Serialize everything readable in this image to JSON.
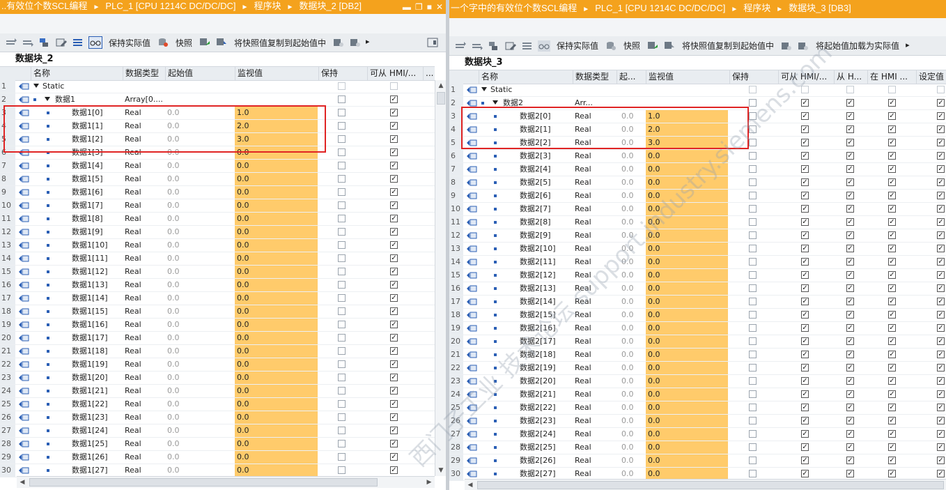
{
  "left": {
    "title": {
      "part1": "..有效位个数SCL编程",
      "part2": "PLC_1 [CPU 1214C DC/DC/DC]",
      "part3": "程序块",
      "part4": "数据块_2 [DB2]"
    },
    "toolbar": {
      "keep_actual": "保持实际值",
      "snapshot": "快照",
      "copy_snapshot": "将快照值复制到起始值中"
    },
    "block_name": "数据块_2",
    "columns": [
      "名称",
      "数据类型",
      "起始值",
      "监视值",
      "保持",
      "可从 HMI/...",
      "..."
    ],
    "static_label": "Static",
    "array_name": "数据1",
    "array_type": "Array[0....",
    "rows": [
      {
        "name": "数据1[0]",
        "type": "Real",
        "start": "0.0",
        "monitor": "1.0"
      },
      {
        "name": "数据1[1]",
        "type": "Real",
        "start": "0.0",
        "monitor": "2.0"
      },
      {
        "name": "数据1[2]",
        "type": "Real",
        "start": "0.0",
        "monitor": "3.0"
      },
      {
        "name": "数据1[3]",
        "type": "Real",
        "start": "0.0",
        "monitor": "0.0"
      },
      {
        "name": "数据1[4]",
        "type": "Real",
        "start": "0.0",
        "monitor": "0.0"
      },
      {
        "name": "数据1[5]",
        "type": "Real",
        "start": "0.0",
        "monitor": "0.0"
      },
      {
        "name": "数据1[6]",
        "type": "Real",
        "start": "0.0",
        "monitor": "0.0"
      },
      {
        "name": "数据1[7]",
        "type": "Real",
        "start": "0.0",
        "monitor": "0.0"
      },
      {
        "name": "数据1[8]",
        "type": "Real",
        "start": "0.0",
        "monitor": "0.0"
      },
      {
        "name": "数据1[9]",
        "type": "Real",
        "start": "0.0",
        "monitor": "0.0"
      },
      {
        "name": "数据1[10]",
        "type": "Real",
        "start": "0.0",
        "monitor": "0.0"
      },
      {
        "name": "数据1[11]",
        "type": "Real",
        "start": "0.0",
        "monitor": "0.0"
      },
      {
        "name": "数据1[12]",
        "type": "Real",
        "start": "0.0",
        "monitor": "0.0"
      },
      {
        "name": "数据1[13]",
        "type": "Real",
        "start": "0.0",
        "monitor": "0.0"
      },
      {
        "name": "数据1[14]",
        "type": "Real",
        "start": "0.0",
        "monitor": "0.0"
      },
      {
        "name": "数据1[15]",
        "type": "Real",
        "start": "0.0",
        "monitor": "0.0"
      },
      {
        "name": "数据1[16]",
        "type": "Real",
        "start": "0.0",
        "monitor": "0.0"
      },
      {
        "name": "数据1[17]",
        "type": "Real",
        "start": "0.0",
        "monitor": "0.0"
      },
      {
        "name": "数据1[18]",
        "type": "Real",
        "start": "0.0",
        "monitor": "0.0"
      },
      {
        "name": "数据1[19]",
        "type": "Real",
        "start": "0.0",
        "monitor": "0.0"
      },
      {
        "name": "数据1[20]",
        "type": "Real",
        "start": "0.0",
        "monitor": "0.0"
      },
      {
        "name": "数据1[21]",
        "type": "Real",
        "start": "0.0",
        "monitor": "0.0"
      },
      {
        "name": "数据1[22]",
        "type": "Real",
        "start": "0.0",
        "monitor": "0.0"
      },
      {
        "name": "数据1[23]",
        "type": "Real",
        "start": "0.0",
        "monitor": "0.0"
      },
      {
        "name": "数据1[24]",
        "type": "Real",
        "start": "0.0",
        "monitor": "0.0"
      },
      {
        "name": "数据1[25]",
        "type": "Real",
        "start": "0.0",
        "monitor": "0.0"
      },
      {
        "name": "数据1[26]",
        "type": "Real",
        "start": "0.0",
        "monitor": "0.0"
      },
      {
        "name": "数据1[27]",
        "type": "Real",
        "start": "0.0",
        "monitor": "0.0"
      }
    ]
  },
  "right": {
    "title": {
      "part1": "一个字中的有效位个数SCL编程",
      "part2": "PLC_1 [CPU 1214C DC/DC/DC]",
      "part3": "程序块",
      "part4": "数据块_3 [DB3]"
    },
    "toolbar": {
      "keep_actual": "保持实际值",
      "snapshot": "快照",
      "copy_snapshot": "将快照值复制到起始值中",
      "load_start": "将起始值加载为实际值"
    },
    "block_name": "数据块_3",
    "columns": [
      "名称",
      "数据类型",
      "起...",
      "监视值",
      "保持",
      "可从 HMI/...",
      "从 H...",
      "在 HMI ...",
      "设定值"
    ],
    "static_label": "Static",
    "array_name": "数据2",
    "array_type": "Arr...",
    "rows": [
      {
        "name": "数据2[0]",
        "type": "Real",
        "start": "0.0",
        "monitor": "1.0"
      },
      {
        "name": "数据2[1]",
        "type": "Real",
        "start": "0.0",
        "monitor": "2.0"
      },
      {
        "name": "数据2[2]",
        "type": "Real",
        "start": "0.0",
        "monitor": "3.0"
      },
      {
        "name": "数据2[3]",
        "type": "Real",
        "start": "0.0",
        "monitor": "0.0"
      },
      {
        "name": "数据2[4]",
        "type": "Real",
        "start": "0.0",
        "monitor": "0.0"
      },
      {
        "name": "数据2[5]",
        "type": "Real",
        "start": "0.0",
        "monitor": "0.0"
      },
      {
        "name": "数据2[6]",
        "type": "Real",
        "start": "0.0",
        "monitor": "0.0"
      },
      {
        "name": "数据2[7]",
        "type": "Real",
        "start": "0.0",
        "monitor": "0.0"
      },
      {
        "name": "数据2[8]",
        "type": "Real",
        "start": "0.0",
        "monitor": "0.0"
      },
      {
        "name": "数据2[9]",
        "type": "Real",
        "start": "0.0",
        "monitor": "0.0"
      },
      {
        "name": "数据2[10]",
        "type": "Real",
        "start": "0.0",
        "monitor": "0.0"
      },
      {
        "name": "数据2[11]",
        "type": "Real",
        "start": "0.0",
        "monitor": "0.0"
      },
      {
        "name": "数据2[12]",
        "type": "Real",
        "start": "0.0",
        "monitor": "0.0"
      },
      {
        "name": "数据2[13]",
        "type": "Real",
        "start": "0.0",
        "monitor": "0.0"
      },
      {
        "name": "数据2[14]",
        "type": "Real",
        "start": "0.0",
        "monitor": "0.0"
      },
      {
        "name": "数据2[15]",
        "type": "Real",
        "start": "0.0",
        "monitor": "0.0"
      },
      {
        "name": "数据2[16]",
        "type": "Real",
        "start": "0.0",
        "monitor": "0.0"
      },
      {
        "name": "数据2[17]",
        "type": "Real",
        "start": "0.0",
        "monitor": "0.0"
      },
      {
        "name": "数据2[18]",
        "type": "Real",
        "start": "0.0",
        "monitor": "0.0"
      },
      {
        "name": "数据2[19]",
        "type": "Real",
        "start": "0.0",
        "monitor": "0.0"
      },
      {
        "name": "数据2[20]",
        "type": "Real",
        "start": "0.0",
        "monitor": "0.0"
      },
      {
        "name": "数据2[21]",
        "type": "Real",
        "start": "0.0",
        "monitor": "0.0"
      },
      {
        "name": "数据2[22]",
        "type": "Real",
        "start": "0.0",
        "monitor": "0.0"
      },
      {
        "name": "数据2[23]",
        "type": "Real",
        "start": "0.0",
        "monitor": "0.0"
      },
      {
        "name": "数据2[24]",
        "type": "Real",
        "start": "0.0",
        "monitor": "0.0"
      },
      {
        "name": "数据2[25]",
        "type": "Real",
        "start": "0.0",
        "monitor": "0.0"
      },
      {
        "name": "数据2[26]",
        "type": "Real",
        "start": "0.0",
        "monitor": "0.0"
      },
      {
        "name": "数据2[27]",
        "type": "Real",
        "start": "0.0",
        "monitor": "0.0"
      }
    ]
  },
  "watermark": "西门子工业 技术论坛 support.industry.siemens.com",
  "colors": {
    "title_bar": "#f4a21d",
    "monitor_cell": "#ffcb6b",
    "highlight_box": "#e02424"
  }
}
